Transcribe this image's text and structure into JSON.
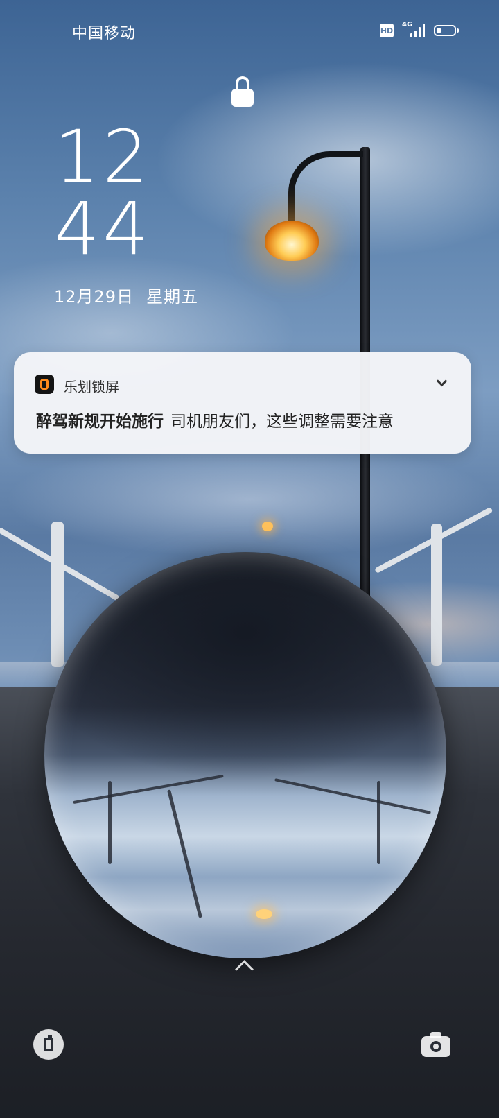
{
  "status_bar": {
    "carrier": "中国移动",
    "hd_label": "HD",
    "network_label": "4G",
    "battery_level": 0.25
  },
  "lock": {
    "icon": "lock-icon"
  },
  "clock": {
    "hour": "12",
    "minute": "44",
    "date": "12月29日",
    "weekday": "星期五"
  },
  "notification": {
    "app_icon": "app-logo-icon",
    "app_name": "乐划锁屏",
    "title": "醉驾新规开始施行",
    "text": "司机朋友们，这些调整需要注意",
    "expand_icon": "chevron-down-icon"
  },
  "bottom": {
    "swipe_icon": "chevron-up-icon",
    "left_shortcut_icon": "phone-icon",
    "right_shortcut_icon": "camera-icon"
  },
  "colors": {
    "notification_bg": "#F4F5F8",
    "app_icon_accent": "#FF8A1C",
    "text_primary": "#222222"
  }
}
